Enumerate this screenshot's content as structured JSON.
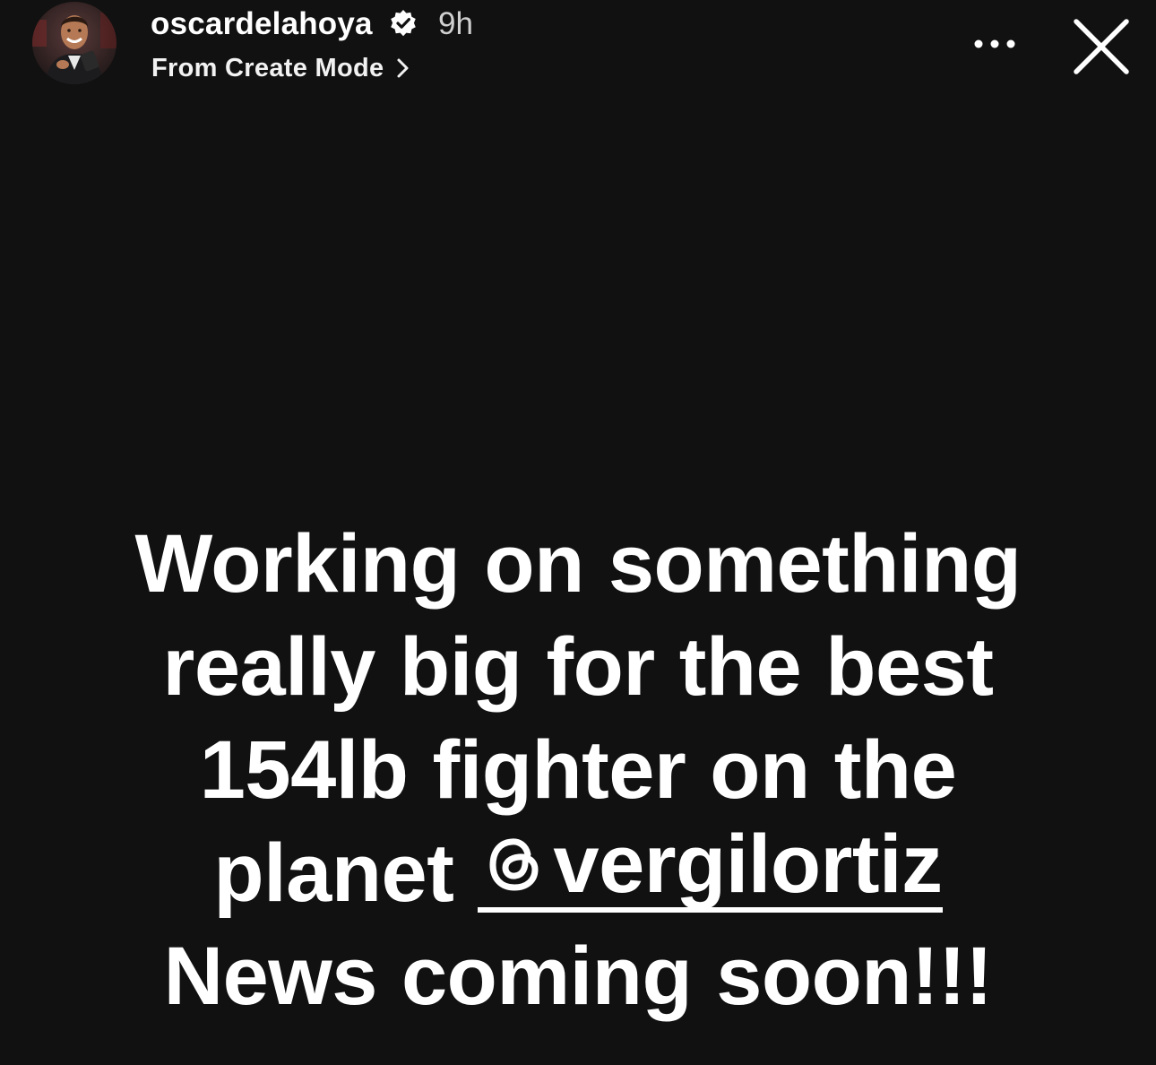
{
  "header": {
    "username": "oscardelahoya",
    "verified": true,
    "timestamp": "9h",
    "subtitle": "From Create Mode",
    "icons": {
      "avatar": "profile-photo",
      "verified": "verified-badge-icon",
      "chevron": "chevron-right-icon",
      "more": "more-horizontal-icon",
      "close": "close-icon"
    }
  },
  "story": {
    "background_color": "#111111",
    "text_color": "#ffffff",
    "lines": [
      "Working on something",
      "really big for the best",
      "154lb fighter on the",
      "News coming soon!!!"
    ],
    "line4_prefix": "planet ",
    "mention": "vergilortiz",
    "mention_icon": "threads-icon"
  }
}
